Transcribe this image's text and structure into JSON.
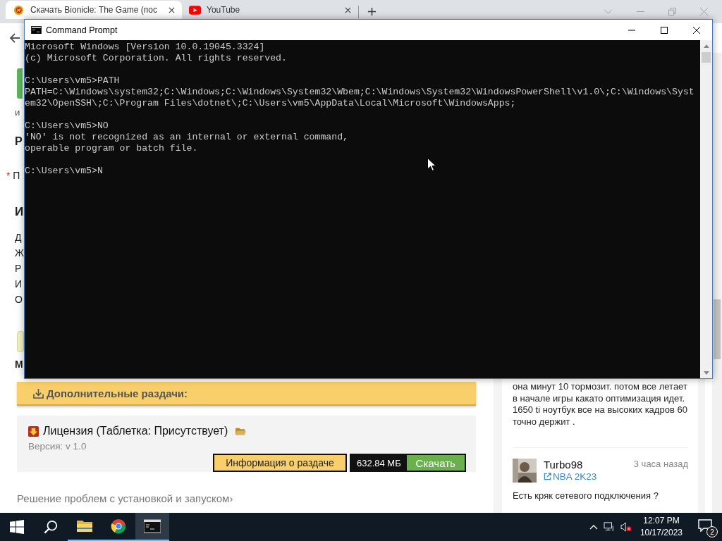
{
  "browser": {
    "tabs": [
      {
        "title": "Скачать Bionicle: The Game (пос",
        "selected": true
      },
      {
        "title": "YouTube",
        "selected": false
      }
    ],
    "page": {
      "upper_fragments": [
        {
          "text": "и",
          "kind": "note"
        },
        {
          "text": "Р",
          "kind": "label"
        },
        {
          "text": "П",
          "kind": "required",
          "marker": "*"
        }
      ],
      "list_heading": "И",
      "list_items": [
        "Д",
        "Ж",
        "Р",
        "И",
        "О"
      ],
      "lower_fragment": "М",
      "banner": "Дополнительные раздачи:",
      "release": {
        "title": "Лицензия (Таблетка: Присутствует)",
        "version": "Версия: v 1.0",
        "info_button": "Информация о раздаче",
        "size": "632.84 МБ",
        "download_button": "Скачать"
      },
      "help_link": "Решение проблем с установкой и запуском›",
      "comments": [
        {
          "text": "она минут 10 тормозит. потом все летает\nв начале игры какато оптимизация идет.\n1650 ti ноутбук все на высоких кадров 60\nточно держит ."
        },
        {
          "author": "Turbo98",
          "time": "3 часа назад",
          "game": "NBA 2K23",
          "text": "Есть кряк сетевого подключения ?"
        }
      ]
    }
  },
  "console": {
    "title": "Command Prompt",
    "blocks": [
      [
        "Microsoft Windows [Version 10.0.19045.3324]",
        "(c) Microsoft Corporation. All rights reserved."
      ],
      [
        "C:\\Users\\vm5>PATH",
        "PATH=C:\\Windows\\system32;C:\\Windows;C:\\Windows\\System32\\Wbem;C:\\Windows\\System32\\WindowsPowerShell\\v1.0\\;C:\\Windows\\Syst",
        "em32\\OpenSSH\\;C:\\Program Files\\dotnet\\;C:\\Users\\vm5\\AppData\\Local\\Microsoft\\WindowsApps;"
      ],
      [
        "C:\\Users\\vm5>NO",
        "'NO' is not recognized as an internal or external command,",
        "operable program or batch file."
      ],
      [
        "C:\\Users\\vm5>N"
      ]
    ]
  },
  "taskbar": {
    "time": "12:07 PM",
    "date": "10/17/2023",
    "notifications": "2"
  }
}
